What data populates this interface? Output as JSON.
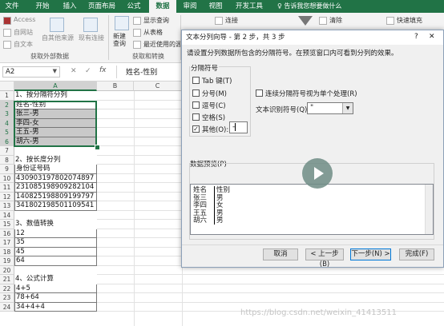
{
  "ribbon": {
    "tabs": [
      "文件",
      "开始",
      "插入",
      "页面布局",
      "公式",
      "数据",
      "审阅",
      "视图",
      "开发工具"
    ],
    "active_tab": "数据",
    "tell_me": "告诉我您想要做什么",
    "get_external": {
      "access": "Access",
      "web": "自网站",
      "text": "自文本",
      "other_sources": "自其他来源",
      "existing_conn": "现有连接",
      "group_label": "获取外部数据"
    },
    "get_transform": {
      "new_query": "新建\n查询",
      "show_queries": "显示查询",
      "from_table": "从表格",
      "recent_sources": "最近使用的源",
      "group_label": "获取和转换"
    },
    "connections": {
      "connections": "连接"
    },
    "sort_filter": {
      "clear": "清除"
    },
    "data_tools": {
      "flash_fill": "快速填充"
    }
  },
  "formula_bar": {
    "name_box": "A2",
    "fx": "fx",
    "cancel": "✕",
    "enter": "✓",
    "content": "姓名-性别"
  },
  "grid": {
    "columns": [
      "A",
      "B",
      "C"
    ],
    "rows": [
      {
        "n": "1",
        "a": "1、按分隔符分列"
      },
      {
        "n": "2",
        "a": "姓名-性别"
      },
      {
        "n": "3",
        "a": "张三-男"
      },
      {
        "n": "4",
        "a": "李四-女"
      },
      {
        "n": "5",
        "a": "王五-男"
      },
      {
        "n": "6",
        "a": "胡六-男"
      },
      {
        "n": "7",
        "a": ""
      },
      {
        "n": "8",
        "a": "2、按长度分列"
      },
      {
        "n": "9",
        "a": "身份证号码"
      },
      {
        "n": "10",
        "a": "430903197802074897"
      },
      {
        "n": "11",
        "a": "231085198909282104"
      },
      {
        "n": "12",
        "a": "140825198809199797"
      },
      {
        "n": "13",
        "a": "341802198501109541"
      },
      {
        "n": "14",
        "a": ""
      },
      {
        "n": "15",
        "a": "3、数值转换"
      },
      {
        "n": "16",
        "a": "12"
      },
      {
        "n": "17",
        "a": "35"
      },
      {
        "n": "18",
        "a": "45"
      },
      {
        "n": "19",
        "a": "64"
      },
      {
        "n": "20",
        "a": ""
      },
      {
        "n": "21",
        "a": "4、公式计算"
      },
      {
        "n": "22",
        "a": "4+5"
      },
      {
        "n": "23",
        "a": "78+64"
      },
      {
        "n": "24",
        "a": "34+4+4"
      }
    ]
  },
  "dialog": {
    "title": "文本分列向导 - 第 2 步，共 3 步",
    "help": "?",
    "close": "✕",
    "instruction": "请设置分列数据所包含的分隔符号。在预览窗口内可看到分列的效果。",
    "delimiters_label": "分隔符号",
    "tab": {
      "label": "Tab 键(T)",
      "checked": false
    },
    "semicolon": {
      "label": "分号(M)",
      "checked": false
    },
    "comma": {
      "label": "逗号(C)",
      "checked": false
    },
    "space": {
      "label": "空格(S)",
      "checked": false
    },
    "other": {
      "label": "其他(O):",
      "checked": true,
      "value": "-"
    },
    "consecutive": {
      "label": "连续分隔符号视为单个处理(R)",
      "checked": false
    },
    "qualifier": {
      "label": "文本识别符号(Q):",
      "value": "\""
    },
    "preview_label": "数据预览(P)",
    "preview": [
      [
        "姓名",
        "性别"
      ],
      [
        "张三",
        "男"
      ],
      [
        "李四",
        "女"
      ],
      [
        "王五",
        "男"
      ],
      [
        "胡六",
        "男"
      ]
    ],
    "buttons": {
      "cancel": "取消",
      "back": "< 上一步(B)",
      "next": "下一步(N) >",
      "finish": "完成(F)"
    }
  },
  "watermark": "https://blog.csdn.net/weixin_41413511",
  "colors": {
    "excel_green": "#217346",
    "selection_gray": "#c9c9c9",
    "play_button": "#6f8d86"
  }
}
